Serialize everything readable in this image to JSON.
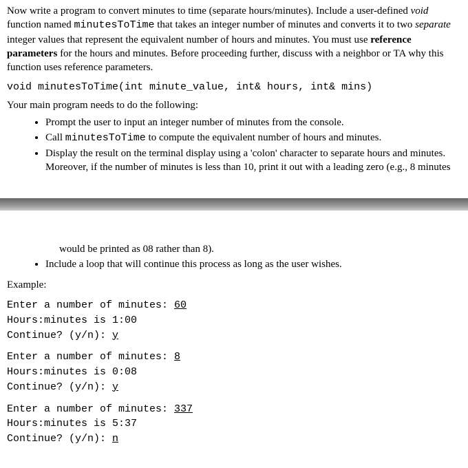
{
  "top": {
    "p1a": "Now write a program to convert minutes to time (separate hours/minutes). Include a user-defined ",
    "p1_void": "void",
    "p1b": " function named ",
    "p1_fn": "minutesToTime",
    "p1c": " that takes an integer number of minutes and converts it to two ",
    "p1_sep": "separate",
    "p1d": " integer values that represent the equivalent number of hours and minutes. You must use ",
    "p1_ref": "reference parameters",
    "p1e": " for the hours and minutes. Before proceeding further, discuss with a neighbor or TA why this function uses reference parameters.",
    "code": "void minutesToTime(int minute_value, int& hours, int& mins)",
    "p2": "Your main program needs to do the following:",
    "li1": "Prompt the user to input an integer number of minutes from the console.",
    "li2a": "Call ",
    "li2_fn": "minutesToTime",
    "li2b": " to compute the equivalent number of hours and minutes.",
    "li3": "Display the result on the terminal display using a 'colon' character to separate hours and minutes. Moreover, if the number of minutes is less than 10, print it out with a leading zero (e.g., 8 minutes"
  },
  "bottom": {
    "cont_text": "would be printed as 08 rather than 8).",
    "li4": "Include a loop that will continue this process as long as the user wishes.",
    "example_label": "Example:",
    "ex1_a": "Enter a number of minutes: ",
    "ex1_in": "60",
    "ex1_out": "Hours:minutes is 1:00",
    "ex1_c": "Continue? (y/n): ",
    "ex1_cn": "y",
    "ex2_a": "Enter a number of minutes: ",
    "ex2_in": "8",
    "ex2_out": "Hours:minutes is 0:08",
    "ex2_c": "Continue? (y/n): ",
    "ex2_cn": "y",
    "ex3_a": "Enter a number of minutes: ",
    "ex3_in": "337",
    "ex3_out": "Hours:minutes is 5:37",
    "ex3_c": "Continue? (y/n): ",
    "ex3_cn": "n"
  }
}
